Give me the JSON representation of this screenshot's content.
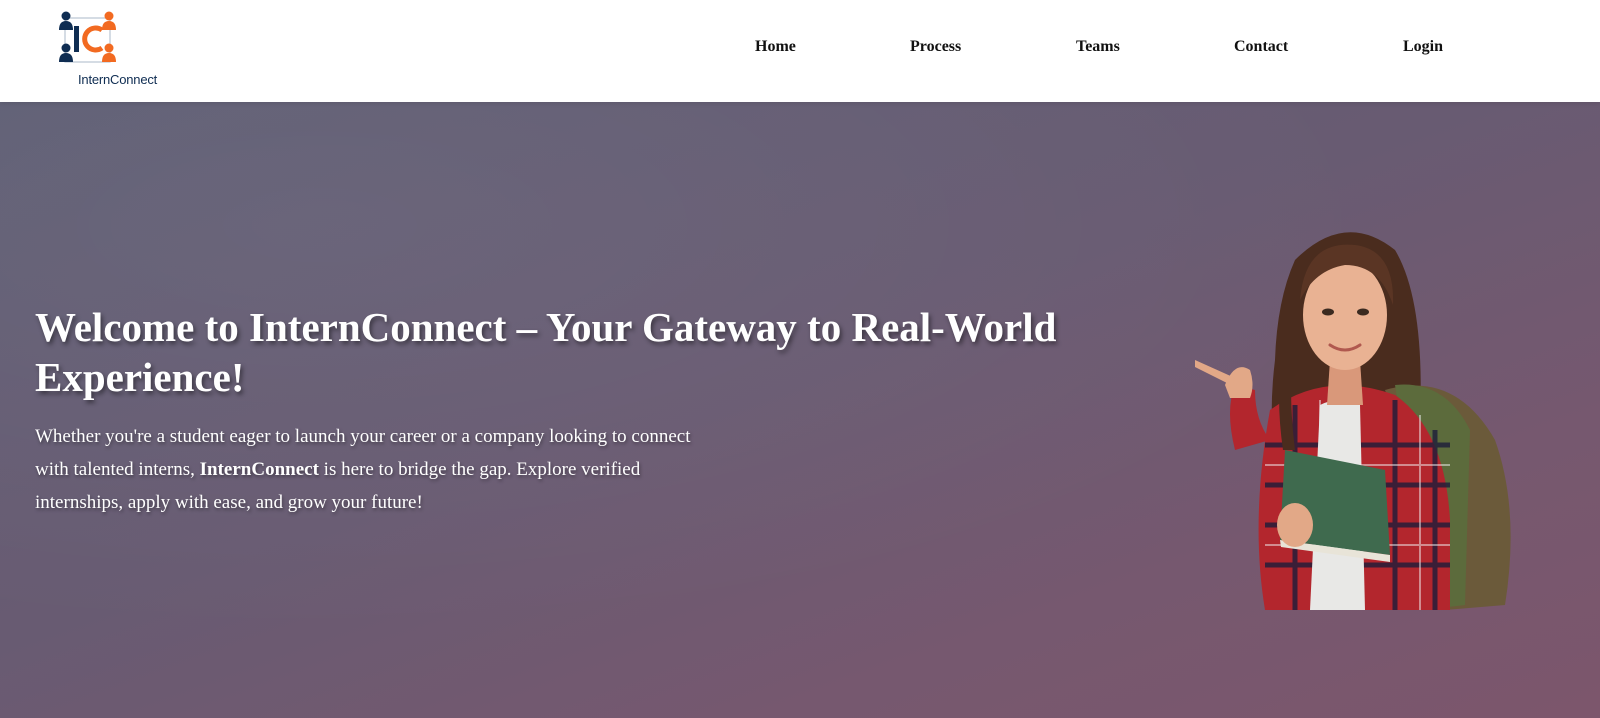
{
  "brand": {
    "logo_letters": "IC",
    "name": "InternConnect"
  },
  "nav": {
    "items": [
      {
        "label": "Home"
      },
      {
        "label": "Process"
      },
      {
        "label": "Teams"
      },
      {
        "label": "Contact"
      },
      {
        "label": "Login"
      }
    ]
  },
  "hero": {
    "title": "Welcome to InternConnect – Your Gateway to Real-World Experience!",
    "text_before": "Whether you're a student eager to launch your career or a company looking to connect with talented interns, ",
    "text_bold": "InternConnect",
    "text_after": " is here to bridge the gap. Explore verified internships, apply with ease, and grow your future!",
    "image": "student-with-book-and-backpack-pointing"
  },
  "colors": {
    "navy": "#0f2d52",
    "orange": "#f26a21",
    "hero_start": "#5e5e74",
    "hero_end": "#7c566c"
  }
}
